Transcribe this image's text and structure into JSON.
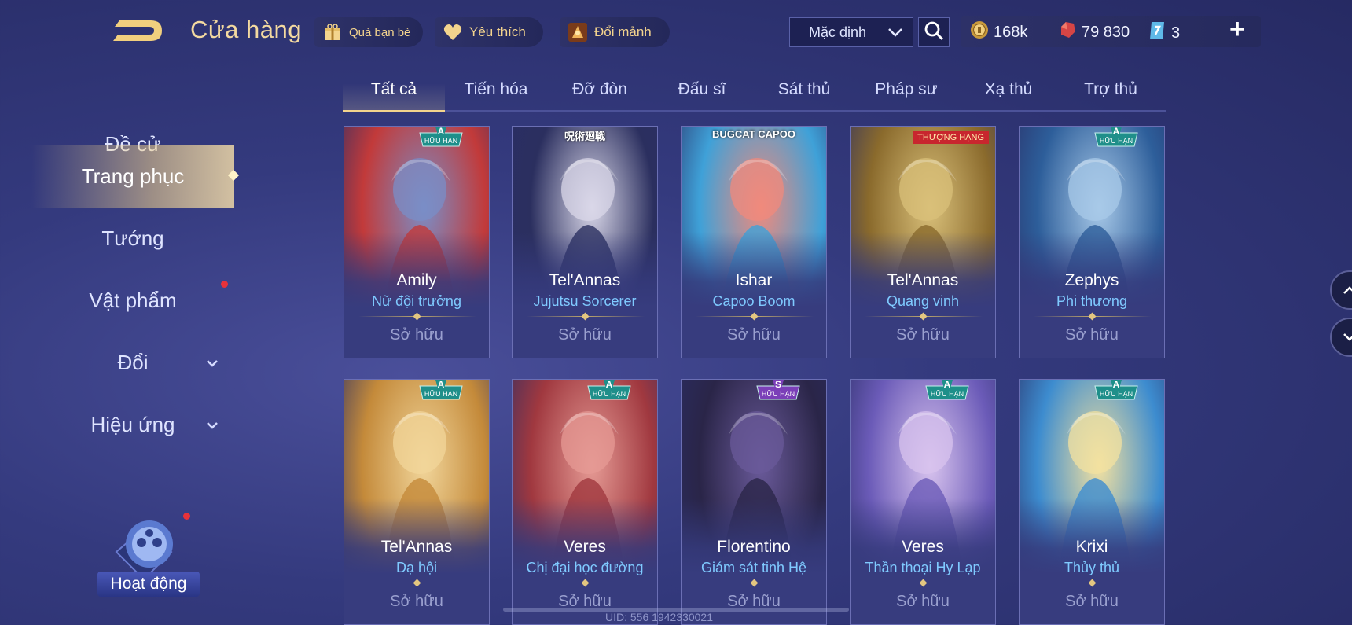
{
  "header": {
    "title": "Cửa hàng",
    "buttons": [
      {
        "label": "Quà bạn bè",
        "icon": "gift-icon"
      },
      {
        "label": "Yêu thích",
        "icon": "heart-icon"
      },
      {
        "label": "Đổi mảnh",
        "icon": "fragment-icon"
      }
    ],
    "sort_label": "Mặc định",
    "currencies": [
      {
        "value": "168k",
        "icon": "gold-coin-icon"
      },
      {
        "value": "79 830",
        "icon": "ruby-icon"
      },
      {
        "value": "3",
        "icon": "voucher-icon"
      }
    ],
    "plus_label": "+"
  },
  "sidebar": {
    "items": [
      {
        "label": "Đề cử"
      },
      {
        "label": "Trang phục"
      },
      {
        "label": "Tướng"
      },
      {
        "label": "Vật phẩm"
      },
      {
        "label": "Đổi"
      },
      {
        "label": "Hiệu ứng"
      }
    ],
    "event_label": "Hoạt động"
  },
  "tabs": [
    "Tất cả",
    "Tiến hóa",
    "Đỡ đòn",
    "Đấu sĩ",
    "Sát thủ",
    "Pháp sư",
    "Xạ thủ",
    "Trợ thủ"
  ],
  "cards": [
    {
      "hero": "Amily",
      "skin": "Nữ đội trưởng",
      "status": "Sở hữu",
      "badge_label": "HỮU HẠN",
      "badge_grade": "A",
      "colors": [
        "#c23a3a",
        "#7a8ec7"
      ]
    },
    {
      "hero": "Tel'Annas",
      "skin": "Jujutsu Sorcerer",
      "status": "Sở hữu",
      "banner": "呪術廻戦",
      "colors": [
        "#2b2f5f",
        "#d9d7e8"
      ]
    },
    {
      "hero": "Ishar",
      "skin": "Capoo Boom",
      "status": "Sở hữu",
      "banner": "BUGCAT CAPOO",
      "colors": [
        "#3fa1d8",
        "#f08a7c"
      ]
    },
    {
      "hero": "Tel'Annas",
      "skin": "Quang vinh",
      "status": "Sở hữu",
      "ribbon": "THƯỢNG HẠNG",
      "colors": [
        "#8a6a2c",
        "#d9c07a"
      ]
    },
    {
      "hero": "Zephys",
      "skin": "Phi thương",
      "status": "Sở hữu",
      "badge_label": "HỮU HẠN",
      "badge_grade": "A",
      "colors": [
        "#2d5e9a",
        "#a8c9e8"
      ]
    },
    {
      "hero": "Tel'Annas",
      "skin": "Dạ hội",
      "status": "Sở hữu",
      "badge_label": "HỮU HẠN",
      "badge_grade": "A",
      "colors": [
        "#c48a3a",
        "#f1d59a"
      ]
    },
    {
      "hero": "Veres",
      "skin": "Chị đại học đường",
      "status": "Sở hữu",
      "badge_label": "HỮU HẠN",
      "badge_grade": "A",
      "colors": [
        "#a0383f",
        "#e59a94"
      ]
    },
    {
      "hero": "Florentino",
      "skin": "Giám sát tinh Hệ",
      "status": "Sở hữu",
      "badge_label": "HỮU HẠN",
      "badge_grade": "S",
      "colors": [
        "#2a2548",
        "#6a5a9a"
      ]
    },
    {
      "hero": "Veres",
      "skin": "Thần thoại Hy Lạp",
      "status": "Sở hữu",
      "badge_label": "HỮU HẠN",
      "badge_grade": "A",
      "colors": [
        "#6b5bb8",
        "#d8c3ee"
      ]
    },
    {
      "hero": "Krixi",
      "skin": "Thủy thủ",
      "status": "Sở hữu",
      "badge_label": "HỮU HẠN",
      "badge_grade": "A",
      "colors": [
        "#3d8ccf",
        "#f3e1a0"
      ]
    }
  ],
  "footer": {
    "uid": "UID: 556 1942330021"
  },
  "colors": {
    "accent_gold": "#f3d48d",
    "skin_text": "#7fcaff",
    "badge_a": "#1f8f8a",
    "badge_s": "#7b3fb8"
  }
}
